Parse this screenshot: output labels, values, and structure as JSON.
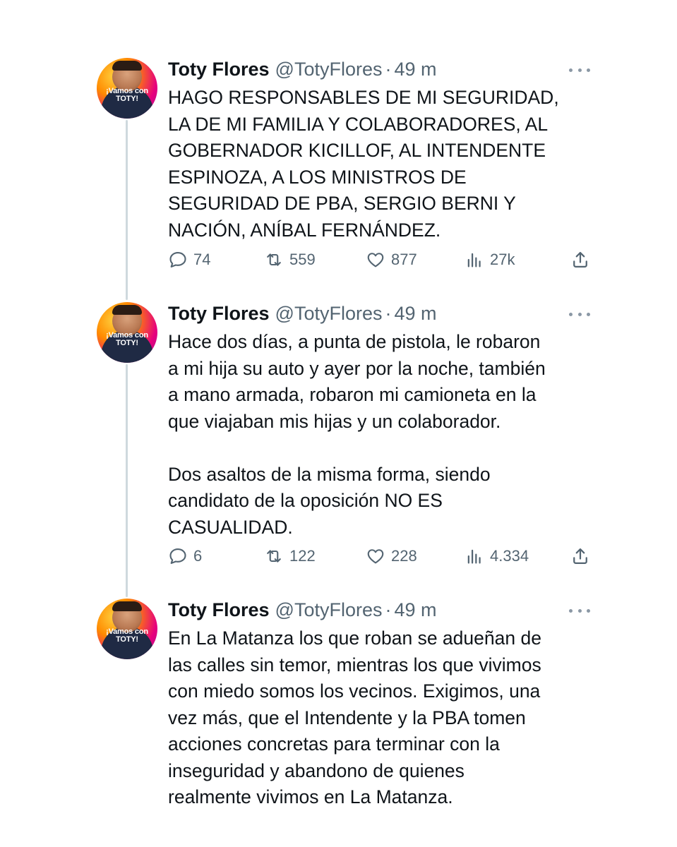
{
  "tweets": [
    {
      "author": {
        "name": "Toty Flores",
        "handle": "@TotyFlores",
        "time": "49 m",
        "avatar_text": "¡Vamos con TOTY!"
      },
      "text": "HAGO RESPONSABLES DE MI SEGURIDAD,\nLA DE MI FAMILIA Y COLABORADORES, AL\nGOBERNADOR KICILLOF, AL INTENDENTE\nESPINOZA, A LOS MINISTROS DE\nSEGURIDAD DE PBA, SERGIO BERNI Y\nNACIÓN, ANÍBAL FERNÁNDEZ.",
      "stats": {
        "replies": "74",
        "retweets": "559",
        "likes": "877",
        "views": "27k"
      }
    },
    {
      "author": {
        "name": "Toty Flores",
        "handle": "@TotyFlores",
        "time": "49 m",
        "avatar_text": "¡Vamos con TOTY!"
      },
      "text": "Hace dos días, a punta de pistola, le robaron\na mi hija su auto y ayer por la noche, también\na mano armada, robaron mi camioneta en la\nque viajaban mis hijas y un colaborador.\n\nDos asaltos de la misma forma, siendo\ncandidato de la oposición NO ES\nCASUALIDAD.",
      "stats": {
        "replies": "6",
        "retweets": "122",
        "likes": "228",
        "views": "4.334"
      }
    },
    {
      "author": {
        "name": "Toty Flores",
        "handle": "@TotyFlores",
        "time": "49 m",
        "avatar_text": "¡Vamos con TOTY!"
      },
      "text": "En La Matanza los que roban se adueñan de\nlas calles sin temor, mientras los que vivimos\ncon miedo somos los vecinos. Exigimos, una\nvez más, que el Intendente y la PBA tomen\nacciones concretas para terminar con la\ninseguridad y abandono de quienes\nrealmente vivimos en La Matanza."
    }
  ],
  "icons": {
    "reply": "reply-icon",
    "retweet": "retweet-icon",
    "like": "heart-icon",
    "views": "views-icon",
    "share": "share-icon",
    "more": "more-icon"
  },
  "colors": {
    "text": "#0f1419",
    "secondary": "#536471",
    "thread_line": "#cfd9de"
  }
}
